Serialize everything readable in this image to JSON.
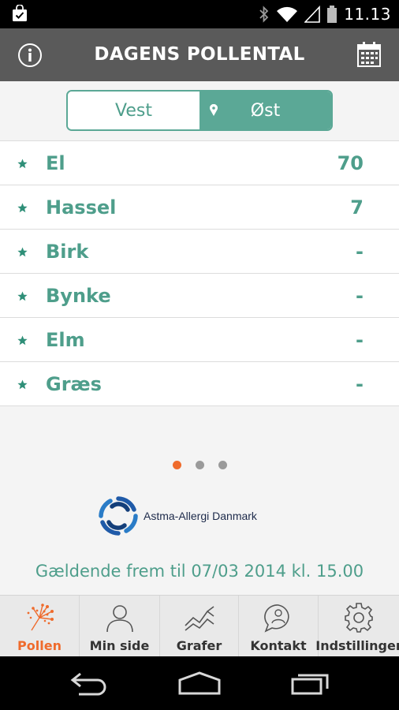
{
  "status_bar": {
    "time": "11.13",
    "icons": [
      "shopping-bag-icon",
      "bluetooth-icon",
      "wifi-icon",
      "signal-icon",
      "battery-icon"
    ]
  },
  "header": {
    "title": "DAGENS POLLENTAL",
    "left_icon": "info-icon",
    "right_icon": "calendar-icon"
  },
  "region_toggle": {
    "options": [
      {
        "label": "Vest",
        "selected": false
      },
      {
        "label": "Øst",
        "selected": true,
        "icon": "location-pin-icon"
      }
    ]
  },
  "pollen_list": [
    {
      "name": "El",
      "value": "70"
    },
    {
      "name": "Hassel",
      "value": "7"
    },
    {
      "name": "Birk",
      "value": "-"
    },
    {
      "name": "Bynke",
      "value": "-"
    },
    {
      "name": "Elm",
      "value": "-"
    },
    {
      "name": "Græs",
      "value": "-"
    }
  ],
  "pager": {
    "count": 3,
    "active_index": 0
  },
  "logo": {
    "text": "Astma-Allergi Danmark"
  },
  "valid_until": "Gældende frem til 07/03 2014 kl. 15.00",
  "bottom_nav": [
    {
      "label": "Pollen",
      "icon": "pollen-icon",
      "active": true
    },
    {
      "label": "Min side",
      "icon": "person-icon",
      "active": false
    },
    {
      "label": "Grafer",
      "icon": "chart-icon",
      "active": false
    },
    {
      "label": "Kontakt",
      "icon": "chat-icon",
      "active": false
    },
    {
      "label": "Indstillinger",
      "icon": "gear-icon",
      "active": false
    }
  ],
  "colors": {
    "accent": "#5ba896",
    "accent_text": "#4e9e8b",
    "active_orange": "#ef6b2c",
    "header_bg": "#5a5a5a"
  }
}
